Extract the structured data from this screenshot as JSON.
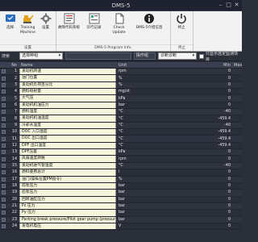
{
  "window": {
    "title": "DMS-5",
    "minimize": "–",
    "maximize": "□",
    "close": "✕"
  },
  "ribbon": {
    "group1": {
      "label": "设置",
      "buttons": [
        {
          "label": "选择"
        },
        {
          "label": "Training Machine"
        },
        {
          "label": "设置"
        }
      ]
    },
    "group2": {
      "label": "DMS-5 Program Info.",
      "buttons": [
        {
          "label": "故障代码系统"
        },
        {
          "label": "诊行记录"
        },
        {
          "label": "Check Update"
        },
        {
          "label": "DMS-5介绍信息"
        }
      ]
    },
    "group3": {
      "label": "终止",
      "buttons": [
        {
          "label": "终止"
        }
      ]
    }
  },
  "search": {
    "label": "搜索",
    "select_value": "选择种组",
    "text_value": "",
    "value_button": "操作组",
    "mode_value": "诊断诊断",
    "checkbox_label": "只显示选定监测项目"
  },
  "table": {
    "headers": {
      "no": "No",
      "name": "Name",
      "unit": "Unit",
      "min": "Min",
      "max": "Max"
    },
    "rows": [
      {
        "no": "1",
        "name": "发动机转速",
        "unit": "rpm",
        "value": "",
        "min": "0"
      },
      {
        "no": "2",
        "name": "油门位置",
        "unit": "%",
        "value": "",
        "min": "0"
      },
      {
        "no": "3",
        "name": "发动机负荷百分比",
        "unit": "%",
        "value": "",
        "min": "0"
      },
      {
        "no": "4",
        "name": "燃料喷射量",
        "unit": "mg/st",
        "value": "",
        "min": "0"
      },
      {
        "no": "5",
        "name": "大气压",
        "unit": "kPa",
        "value": "",
        "min": "0"
      },
      {
        "no": "6",
        "name": "发动机机油压力",
        "unit": "bar",
        "value": "",
        "min": "0"
      },
      {
        "no": "7",
        "name": "燃料温度",
        "unit": "°C",
        "value": "",
        "min": "-40"
      },
      {
        "no": "8",
        "name": "发动机机油温度",
        "unit": "°C",
        "value": "",
        "min": "-459.4"
      },
      {
        "no": "9",
        "name": "冷却水温度",
        "unit": "°C",
        "value": "",
        "min": "-40"
      },
      {
        "no": "10",
        "name": "DOC 入口温度",
        "unit": "°C",
        "value": "",
        "min": "-459.4"
      },
      {
        "no": "11",
        "name": "DOC 出口温度",
        "unit": "°C",
        "value": "",
        "min": "-459.4"
      },
      {
        "no": "12",
        "name": "DPF 出口温度",
        "unit": "°C",
        "value": "",
        "min": "-459.4"
      },
      {
        "no": "13",
        "name": "DPF压差",
        "unit": "kPa",
        "value": "",
        "min": "0"
      },
      {
        "no": "14",
        "name": "风扇速度转数",
        "unit": "rpm",
        "value": "",
        "min": "0"
      },
      {
        "no": "15",
        "name": "发动机进气管温度",
        "unit": "°C",
        "value": "",
        "min": "-40"
      },
      {
        "no": "16",
        "name": "燃料使用总计",
        "unit": "l",
        "value": "",
        "min": "0"
      },
      {
        "no": "17",
        "name": "油门(操纵位置PM指令)",
        "unit": "%",
        "value": "",
        "min": "0"
      },
      {
        "no": "18",
        "name": "前泵压力",
        "unit": "bar",
        "value": "",
        "min": "0"
      },
      {
        "no": "19",
        "name": "后泵压力",
        "unit": "bar",
        "value": "",
        "min": "0"
      },
      {
        "no": "20",
        "name": "回转油缸压力",
        "unit": "bar",
        "value": "",
        "min": "0"
      },
      {
        "no": "21",
        "name": "Pz 压力",
        "unit": "bar",
        "value": "",
        "min": "0"
      },
      {
        "no": "22",
        "name": "Py 压力",
        "unit": "bar",
        "value": "",
        "min": "0"
      },
      {
        "no": "23",
        "name": "Parking break pressure/Pilot gear pump (pressure)",
        "unit": "bar",
        "value": "",
        "min": "0"
      },
      {
        "no": "24",
        "name": "发电机电压",
        "unit": "V",
        "value": "",
        "min": "0"
      }
    ]
  }
}
